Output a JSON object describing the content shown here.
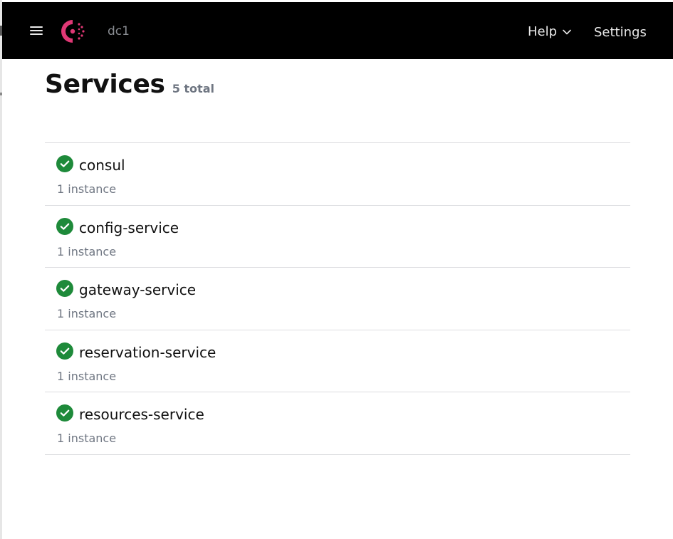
{
  "header": {
    "datacenter": "dc1",
    "help_label": "Help",
    "settings_label": "Settings",
    "brand_color": "#e03875",
    "background_color": "#000000"
  },
  "page": {
    "title": "Services",
    "total": "5 total"
  },
  "services": [
    {
      "name": "consul",
      "instances": "1 instance",
      "status": "passing"
    },
    {
      "name": "config-service",
      "instances": "1 instance",
      "status": "passing"
    },
    {
      "name": "gateway-service",
      "instances": "1 instance",
      "status": "passing"
    },
    {
      "name": "reservation-service",
      "instances": "1 instance",
      "status": "passing"
    },
    {
      "name": "resources-service",
      "instances": "1 instance",
      "status": "passing"
    }
  ],
  "colors": {
    "passing": "#1e8a3a"
  }
}
